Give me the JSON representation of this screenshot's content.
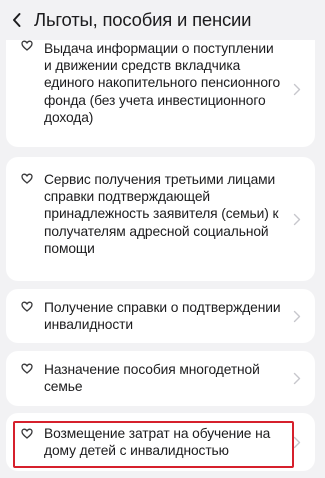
{
  "header": {
    "title": "Льготы, пособия и пенсии",
    "back_icon": "chevron-left-icon"
  },
  "services": [
    {
      "label": "Выдача информации о поступлении и движении средств вкладчика единого накопительного пенсионного фонда (без учета инвестиционного дохода)",
      "favorite_icon": "heart-outline-icon",
      "chevron_icon": "chevron-right-icon"
    },
    {
      "label": "Сервис получения третьими лицами справки подтверждающей принадлежность заявителя (семьи) к получателям адресной социальной помощи",
      "favorite_icon": "heart-outline-icon",
      "chevron_icon": "chevron-right-icon"
    },
    {
      "label": "Получение справки о подтверждении инвалидности",
      "favorite_icon": "heart-outline-icon",
      "chevron_icon": "chevron-right-icon"
    },
    {
      "label": "Назначение пособия многодетной семье",
      "favorite_icon": "heart-outline-icon",
      "chevron_icon": "chevron-right-icon"
    },
    {
      "label": "Возмещение затрат на обучение на дому детей с инвалидностью",
      "favorite_icon": "heart-outline-icon",
      "chevron_icon": "chevron-right-icon",
      "highlighted": true
    }
  ],
  "colors": {
    "background": "#f2f2f4",
    "card": "#ffffff",
    "text": "#1c1c1e",
    "chevron": "#c7c7cc",
    "highlight": "#d6202c"
  }
}
